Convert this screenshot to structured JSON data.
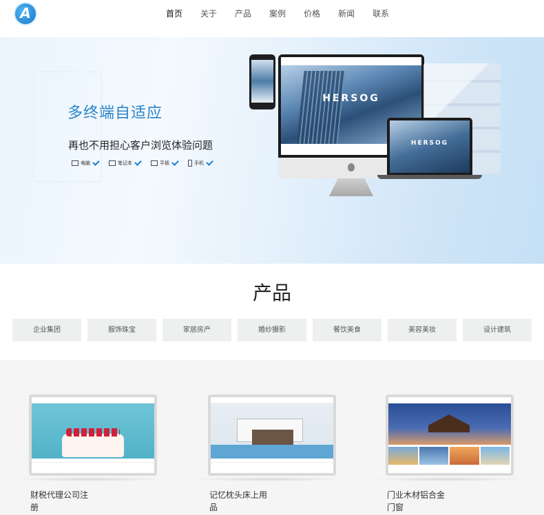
{
  "header": {
    "logo_letter": "A",
    "nav": [
      "首页",
      "关于",
      "产品",
      "案例",
      "价格",
      "新闻",
      "联系"
    ]
  },
  "banner": {
    "title": "多终端自适应",
    "subtitle": "再也不用担心客户浏览体验问题",
    "devices": [
      {
        "label": "电脑",
        "icon": "monitor-icon"
      },
      {
        "label": "笔记本",
        "icon": "laptop-icon"
      },
      {
        "label": "平板",
        "icon": "tablet-icon"
      },
      {
        "label": "手机",
        "icon": "phone-icon"
      }
    ],
    "mockup_brand": "HERSOG",
    "accent_color": "#2a83c8"
  },
  "products": {
    "title": "产品",
    "categories": [
      "企业集团",
      "服饰珠宝",
      "家居房产",
      "婚纱摄影",
      "餐饮美食",
      "美容美妆",
      "设计建筑"
    ]
  },
  "showcase": {
    "cards": [
      {
        "label": "财税代理公司注册"
      },
      {
        "label": "记忆枕头床上用品"
      },
      {
        "label": "门业木材铝合金门窗"
      }
    ]
  }
}
